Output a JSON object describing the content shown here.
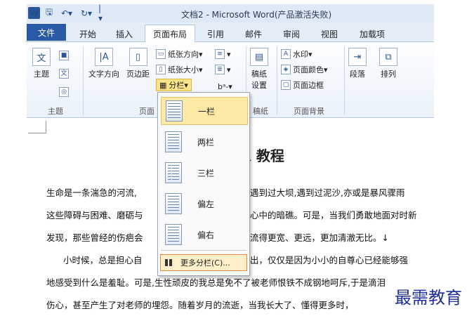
{
  "window": {
    "title": "文档2 - Microsoft Word(产品激活失败)",
    "quick_access": {
      "app": "W",
      "save": "🖫",
      "undo": "↶▾",
      "redo": "↻▾",
      "separator": "|▾"
    }
  },
  "tabs": [
    "文件",
    "开始",
    "插入",
    "页面布局",
    "引用",
    "邮件",
    "审阅",
    "视图",
    "加载项"
  ],
  "active_tab": "页面布局",
  "ribbon": {
    "theme": {
      "label": "主题",
      "group": "主题"
    },
    "page_setup": {
      "text_direction": "文字方向",
      "margins": "页边距",
      "orientation": "纸张方向",
      "size": "纸张大小",
      "columns": "分栏",
      "breaks": "",
      "line_numbers": "",
      "hyphenation": "bᵃ-",
      "group": "页面"
    },
    "draft": {
      "label_1": "稿纸",
      "label_2": "设置",
      "group": "稿纸"
    },
    "page_background": {
      "watermark": "水印",
      "page_color": "页面颜色",
      "page_borders": "页面边框",
      "group": "页面背景"
    },
    "paragraph": {
      "label": "段落"
    },
    "arrange": {
      "label": "排列"
    }
  },
  "columns_menu": {
    "items": [
      "一栏",
      "两栏",
      "三栏",
      "偏左",
      "偏右"
    ],
    "selected": "一栏",
    "more": "更多分栏(C)..."
  },
  "document": {
    "title": "ord 教程",
    "lines": [
      "生命是一条湍急的河流,",
      "这些障碍与困难、磨砺与",
      "发现，那些曾经的伤疤会"
    ],
    "lines_right": [
      "遇到过大坝,遇到过泥沙,亦或是暴风骤雨",
      "心中的暗礁。可是，当我们勇敢地面对时新",
      "流得更宽、更远，更加清澈无比。↓"
    ],
    "para2": [
      "小时候，总是担心自",
      "地感受到什么是羞耻。可是,生性顽皮的我总是免不了被老师恨铁不成钢地呵斥,于是滴泪",
      "伤心，甚至产生了对老师的埋怨。随着岁月的流逝，当我长大了、懂得更多时，"
    ],
    "para2_right": "出，仅仅是因为小小的自尊心已经能够强"
  },
  "watermark_text": "最需教育"
}
